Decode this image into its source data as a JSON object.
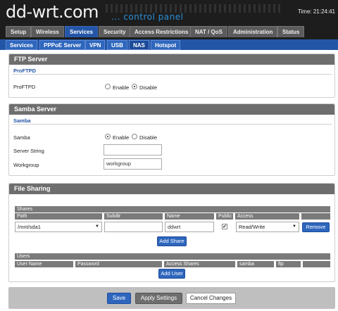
{
  "header": {
    "logo": "dd-wrt.com",
    "subtitle": "... control panel",
    "time": "Time: 21:24:41"
  },
  "main_tabs": [
    "Setup",
    "Wireless",
    "Services",
    "Security",
    "Access Restrictions",
    "NAT / QoS",
    "Administration",
    "Status"
  ],
  "main_tabs_active": "Services",
  "sub_tabs": [
    "Services",
    "PPPoE Server",
    "VPN",
    "USB",
    "NAS",
    "Hotspot"
  ],
  "sub_tabs_active": "NAS",
  "ftp": {
    "title": "FTP Server",
    "legend": "ProFTPD",
    "proftpd_label": "ProFTPD",
    "enable": "Enable",
    "disable": "Disable",
    "selected": "Disable"
  },
  "samba": {
    "title": "Samba Server",
    "legend": "Samba",
    "samba_label": "Samba",
    "enable": "Enable",
    "disable": "Disable",
    "selected": "Enable",
    "server_string_label": "Server String",
    "server_string_value": "",
    "workgroup_label": "Workgroup",
    "workgroup_value": "workgroup"
  },
  "file_sharing": {
    "title": "File Sharing",
    "shares_header": "Shares",
    "cols": {
      "path": "Path",
      "subdir": "Subdir",
      "name": "Name",
      "public": "Public",
      "access": "Access"
    },
    "row": {
      "path": "/mnt/sda1",
      "subdir": "",
      "name": "ddwrt",
      "public": true,
      "access": "Read/Write"
    },
    "remove_label": "Remove",
    "add_share_label": "Add Share",
    "users_header": "Users",
    "user_cols": {
      "username": "User Name",
      "password": "Password",
      "access_shares": "Access Shares",
      "samba": "samba",
      "ftp": "ftp"
    },
    "add_user_label": "Add User"
  },
  "footer": {
    "save": "Save",
    "apply": "Apply Settings",
    "cancel": "Cancel Changes"
  },
  "colors": {
    "accent": "#2456a7",
    "section_header": "#6e6e6e",
    "header_bg": "#1d1d1d"
  }
}
